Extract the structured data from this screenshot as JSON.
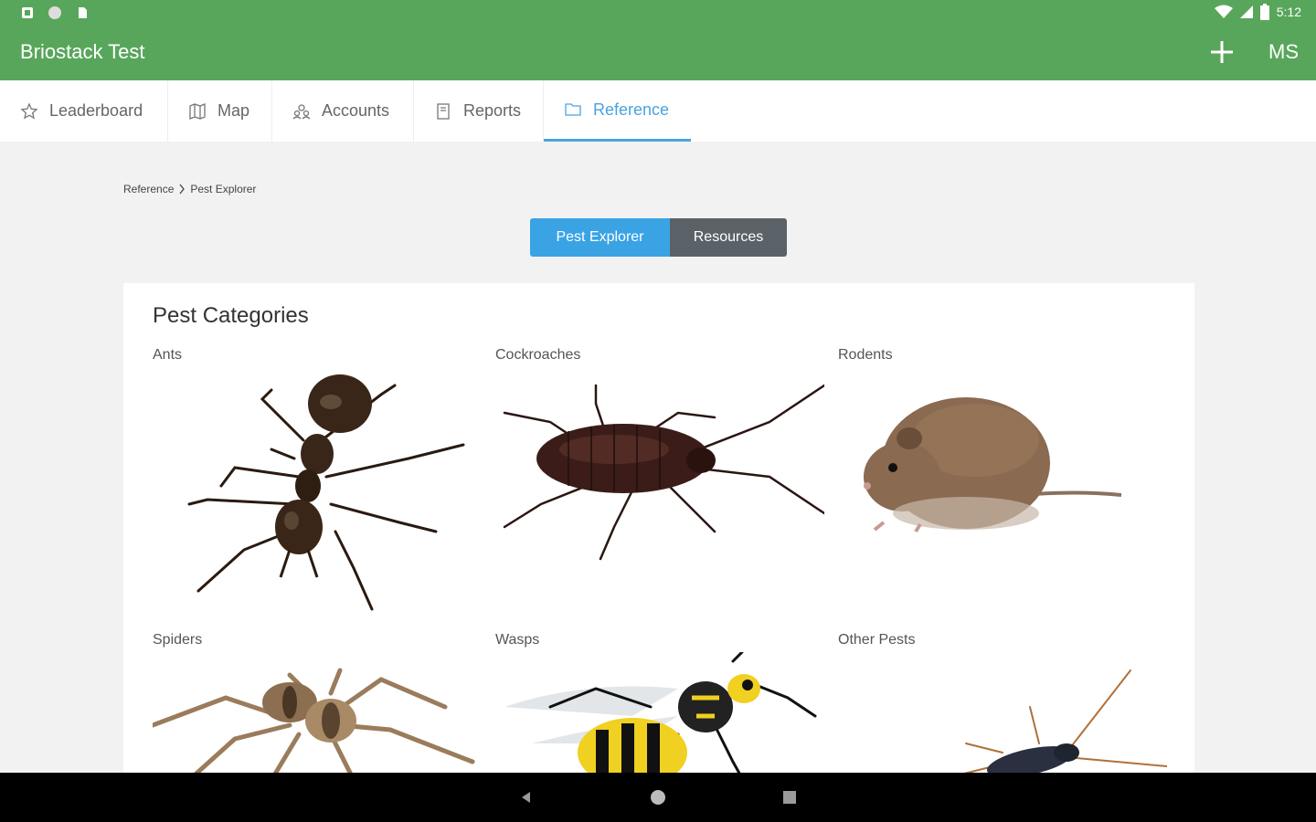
{
  "status_bar": {
    "time": "5:12"
  },
  "app_bar": {
    "title": "Briostack Test",
    "user_initials": "MS"
  },
  "tabs": [
    {
      "label": "Leaderboard",
      "icon": "star-icon"
    },
    {
      "label": "Map",
      "icon": "map-icon"
    },
    {
      "label": "Accounts",
      "icon": "accounts-icon"
    },
    {
      "label": "Reports",
      "icon": "reports-icon"
    },
    {
      "label": "Reference",
      "icon": "folder-icon",
      "active": true
    }
  ],
  "breadcrumb": {
    "parent": "Reference",
    "current": "Pest Explorer"
  },
  "segment": {
    "option_1": "Pest Explorer",
    "option_2": "Resources",
    "selected": "Pest Explorer"
  },
  "card": {
    "title": "Pest Categories",
    "categories": [
      {
        "label": "Ants"
      },
      {
        "label": "Cockroaches"
      },
      {
        "label": "Rodents"
      },
      {
        "label": "Spiders"
      },
      {
        "label": "Wasps"
      },
      {
        "label": "Other Pests"
      }
    ]
  },
  "colors": {
    "app_bar": "#58a65b",
    "accent": "#3aa3e3",
    "segment_inactive": "#5a6268"
  }
}
